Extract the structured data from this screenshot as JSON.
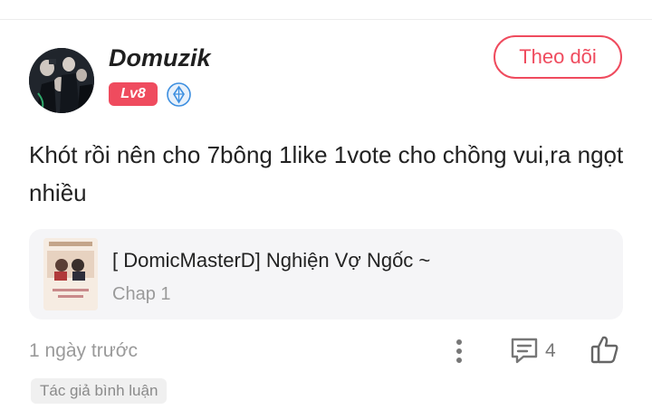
{
  "user": {
    "name": "Domuzik",
    "level": "Lv8",
    "rank_icon": "diamond-rank-icon",
    "avatar_icon": "avatar"
  },
  "follow": {
    "label": "Theo dõi"
  },
  "comment": {
    "text": "Khót rồi nên cho 7bông 1like 1vote cho chồng vui,ra ngọt nhiều"
  },
  "chapter": {
    "title": "[ DomicMasterD] Nghiện Vợ Ngốc ~",
    "chapter": "Chap 1"
  },
  "meta": {
    "time": "1 ngày trước",
    "reply_count": "4",
    "author_tag": "Tác giả bình luận"
  },
  "colors": {
    "accent": "#ef4b5e",
    "rank_blue": "#3d8fe0",
    "muted": "#9a9a9a",
    "card_bg": "#f5f5f7"
  }
}
